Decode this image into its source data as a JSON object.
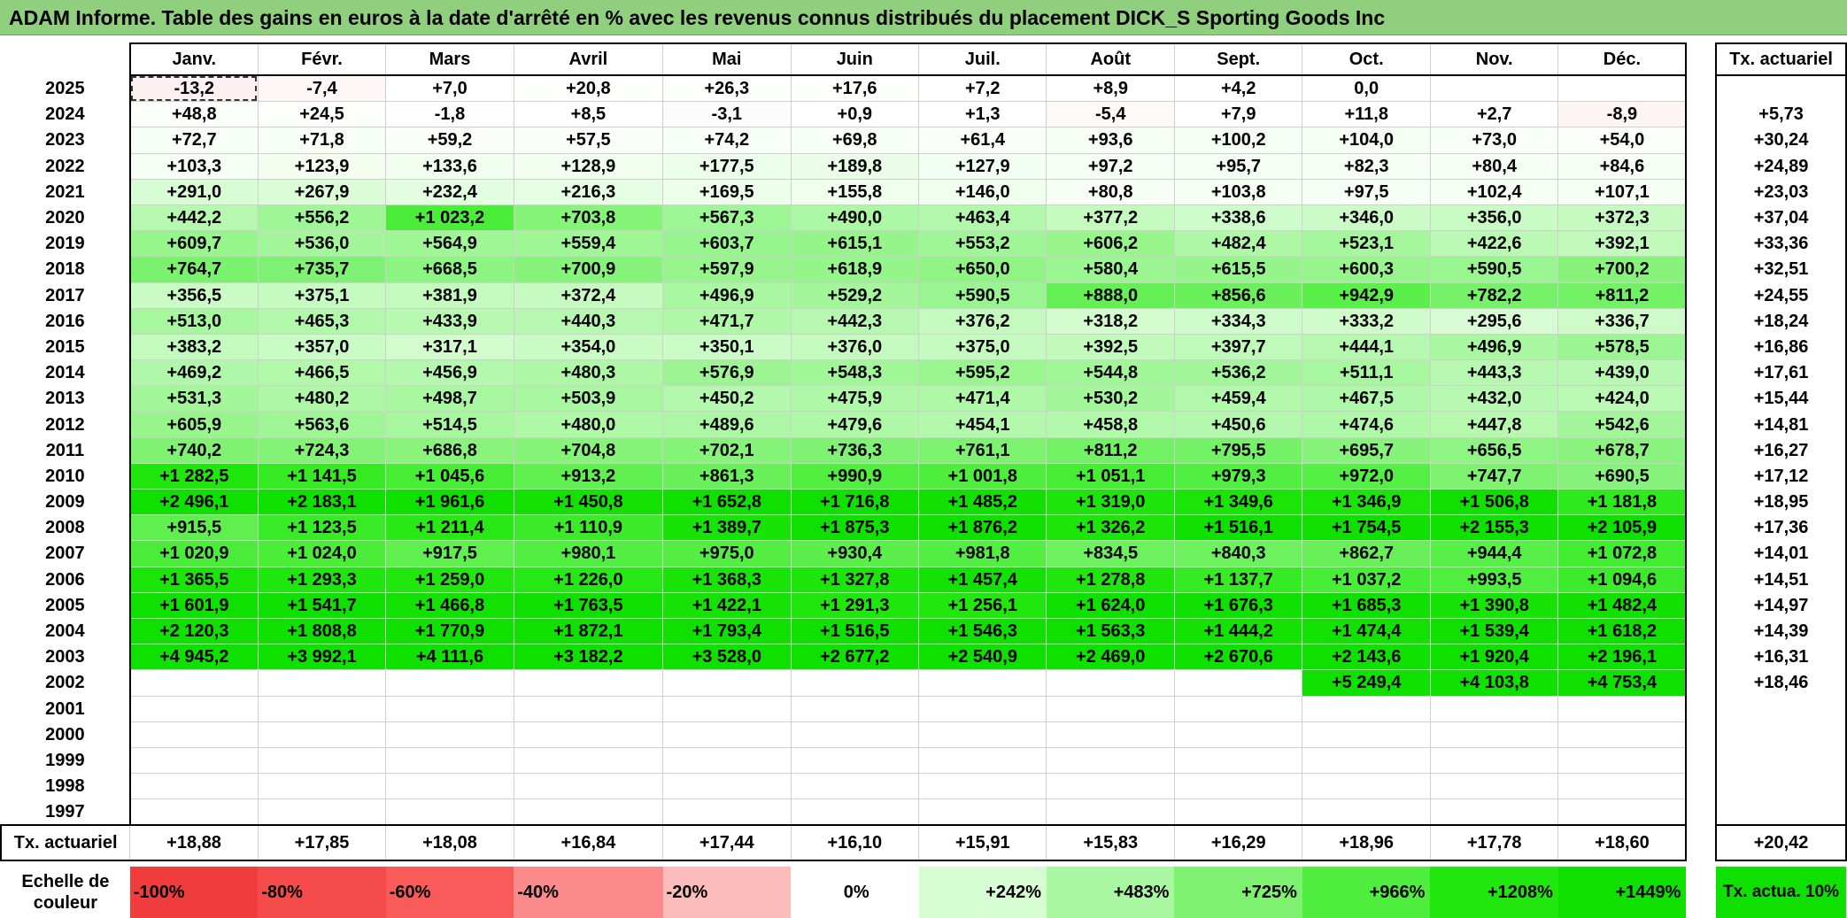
{
  "title": "ADAM Informe. Table des gains en euros à la date d'arrêté en % avec les revenus connus distribués du placement DICK_S Sporting Goods Inc",
  "months": [
    "Janv.",
    "Févr.",
    "Mars",
    "Avril",
    "Mai",
    "Juin",
    "Juil.",
    "Août",
    "Sept.",
    "Oct.",
    "Nov.",
    "Déc."
  ],
  "tax_header": "Tx. actuariel",
  "rows": [
    {
      "year": "2025",
      "values": [
        "-13,2",
        "-7,4",
        "+7,0",
        "+20,8",
        "+26,3",
        "+17,6",
        "+7,2",
        "+8,9",
        "+4,2",
        "0,0",
        "",
        ""
      ],
      "tax": ""
    },
    {
      "year": "2024",
      "values": [
        "+48,8",
        "+24,5",
        "-1,8",
        "+8,5",
        "-3,1",
        "+0,9",
        "+1,3",
        "-5,4",
        "+7,9",
        "+11,8",
        "+2,7",
        "-8,9"
      ],
      "tax": "+5,73"
    },
    {
      "year": "2023",
      "values": [
        "+72,7",
        "+71,8",
        "+59,2",
        "+57,5",
        "+74,2",
        "+69,8",
        "+61,4",
        "+93,6",
        "+100,2",
        "+104,0",
        "+73,0",
        "+54,0"
      ],
      "tax": "+30,24"
    },
    {
      "year": "2022",
      "values": [
        "+103,3",
        "+123,9",
        "+133,6",
        "+128,9",
        "+177,5",
        "+189,8",
        "+127,9",
        "+97,2",
        "+95,7",
        "+82,3",
        "+80,4",
        "+84,6"
      ],
      "tax": "+24,89"
    },
    {
      "year": "2021",
      "values": [
        "+291,0",
        "+267,9",
        "+232,4",
        "+216,3",
        "+169,5",
        "+155,8",
        "+146,0",
        "+80,8",
        "+103,8",
        "+97,5",
        "+102,4",
        "+107,1"
      ],
      "tax": "+23,03"
    },
    {
      "year": "2020",
      "values": [
        "+442,2",
        "+556,2",
        "+1 023,2",
        "+703,8",
        "+567,3",
        "+490,0",
        "+463,4",
        "+377,2",
        "+338,6",
        "+346,0",
        "+356,0",
        "+372,3"
      ],
      "tax": "+37,04"
    },
    {
      "year": "2019",
      "values": [
        "+609,7",
        "+536,0",
        "+564,9",
        "+559,4",
        "+603,7",
        "+615,1",
        "+553,2",
        "+606,2",
        "+482,4",
        "+523,1",
        "+422,6",
        "+392,1"
      ],
      "tax": "+33,36"
    },
    {
      "year": "2018",
      "values": [
        "+764,7",
        "+735,7",
        "+668,5",
        "+700,9",
        "+597,9",
        "+618,9",
        "+650,0",
        "+580,4",
        "+615,5",
        "+600,3",
        "+590,5",
        "+700,2"
      ],
      "tax": "+32,51"
    },
    {
      "year": "2017",
      "values": [
        "+356,5",
        "+375,1",
        "+381,9",
        "+372,4",
        "+496,9",
        "+529,2",
        "+590,5",
        "+888,0",
        "+856,6",
        "+942,9",
        "+782,2",
        "+811,2"
      ],
      "tax": "+24,55"
    },
    {
      "year": "2016",
      "values": [
        "+513,0",
        "+465,3",
        "+433,9",
        "+440,3",
        "+471,7",
        "+442,3",
        "+376,2",
        "+318,2",
        "+334,3",
        "+333,2",
        "+295,6",
        "+336,7"
      ],
      "tax": "+18,24"
    },
    {
      "year": "2015",
      "values": [
        "+383,2",
        "+357,0",
        "+317,1",
        "+354,0",
        "+350,1",
        "+376,0",
        "+375,0",
        "+392,5",
        "+397,7",
        "+444,1",
        "+496,9",
        "+578,5"
      ],
      "tax": "+16,86"
    },
    {
      "year": "2014",
      "values": [
        "+469,2",
        "+466,5",
        "+456,9",
        "+480,3",
        "+576,9",
        "+548,3",
        "+595,2",
        "+544,8",
        "+536,2",
        "+511,1",
        "+443,3",
        "+439,0"
      ],
      "tax": "+17,61"
    },
    {
      "year": "2013",
      "values": [
        "+531,3",
        "+480,2",
        "+498,7",
        "+503,9",
        "+450,2",
        "+475,9",
        "+471,4",
        "+530,2",
        "+459,4",
        "+467,5",
        "+432,0",
        "+424,0"
      ],
      "tax": "+15,44"
    },
    {
      "year": "2012",
      "values": [
        "+605,9",
        "+563,6",
        "+514,5",
        "+480,0",
        "+489,6",
        "+479,6",
        "+454,1",
        "+458,8",
        "+450,6",
        "+474,6",
        "+447,8",
        "+542,6"
      ],
      "tax": "+14,81"
    },
    {
      "year": "2011",
      "values": [
        "+740,2",
        "+724,3",
        "+686,8",
        "+704,8",
        "+702,1",
        "+736,3",
        "+761,1",
        "+811,2",
        "+795,5",
        "+695,7",
        "+656,5",
        "+678,7"
      ],
      "tax": "+16,27"
    },
    {
      "year": "2010",
      "values": [
        "+1 282,5",
        "+1 141,5",
        "+1 045,6",
        "+913,2",
        "+861,3",
        "+990,9",
        "+1 001,8",
        "+1 051,1",
        "+979,3",
        "+972,0",
        "+747,7",
        "+690,5"
      ],
      "tax": "+17,12"
    },
    {
      "year": "2009",
      "values": [
        "+2 496,1",
        "+2 183,1",
        "+1 961,6",
        "+1 450,8",
        "+1 652,8",
        "+1 716,8",
        "+1 485,2",
        "+1 319,0",
        "+1 349,6",
        "+1 346,9",
        "+1 506,8",
        "+1 181,8"
      ],
      "tax": "+18,95"
    },
    {
      "year": "2008",
      "values": [
        "+915,5",
        "+1 123,5",
        "+1 211,4",
        "+1 110,9",
        "+1 389,7",
        "+1 875,3",
        "+1 876,2",
        "+1 326,2",
        "+1 516,1",
        "+1 754,5",
        "+2 155,3",
        "+2 105,9"
      ],
      "tax": "+17,36"
    },
    {
      "year": "2007",
      "values": [
        "+1 020,9",
        "+1 024,0",
        "+917,5",
        "+980,1",
        "+975,0",
        "+930,4",
        "+981,8",
        "+834,5",
        "+840,3",
        "+862,7",
        "+944,4",
        "+1 072,8"
      ],
      "tax": "+14,01"
    },
    {
      "year": "2006",
      "values": [
        "+1 365,5",
        "+1 293,3",
        "+1 259,0",
        "+1 226,0",
        "+1 368,3",
        "+1 327,8",
        "+1 457,4",
        "+1 278,8",
        "+1 137,7",
        "+1 037,2",
        "+993,5",
        "+1 094,6"
      ],
      "tax": "+14,51"
    },
    {
      "year": "2005",
      "values": [
        "+1 601,9",
        "+1 541,7",
        "+1 466,8",
        "+1 763,5",
        "+1 422,1",
        "+1 291,3",
        "+1 256,1",
        "+1 624,0",
        "+1 676,3",
        "+1 685,3",
        "+1 390,8",
        "+1 482,4"
      ],
      "tax": "+14,97"
    },
    {
      "year": "2004",
      "values": [
        "+2 120,3",
        "+1 808,8",
        "+1 770,9",
        "+1 872,1",
        "+1 793,4",
        "+1 516,5",
        "+1 546,3",
        "+1 563,3",
        "+1 444,2",
        "+1 474,4",
        "+1 539,4",
        "+1 618,2"
      ],
      "tax": "+14,39"
    },
    {
      "year": "2003",
      "values": [
        "+4 945,2",
        "+3 992,1",
        "+4 111,6",
        "+3 182,2",
        "+3 528,0",
        "+2 677,2",
        "+2 540,9",
        "+2 469,0",
        "+2 670,6",
        "+2 143,6",
        "+1 920,4",
        "+2 196,1"
      ],
      "tax": "+16,31"
    },
    {
      "year": "2002",
      "values": [
        "",
        "",
        "",
        "",
        "",
        "",
        "",
        "",
        "",
        "+5 249,4",
        "+4 103,8",
        "+4 753,4"
      ],
      "tax": "+18,46"
    },
    {
      "year": "2001",
      "values": [
        "",
        "",
        "",
        "",
        "",
        "",
        "",
        "",
        "",
        "",
        "",
        ""
      ],
      "tax": ""
    },
    {
      "year": "2000",
      "values": [
        "",
        "",
        "",
        "",
        "",
        "",
        "",
        "",
        "",
        "",
        "",
        ""
      ],
      "tax": ""
    },
    {
      "year": "1999",
      "values": [
        "",
        "",
        "",
        "",
        "",
        "",
        "",
        "",
        "",
        "",
        "",
        ""
      ],
      "tax": ""
    },
    {
      "year": "1998",
      "values": [
        "",
        "",
        "",
        "",
        "",
        "",
        "",
        "",
        "",
        "",
        "",
        ""
      ],
      "tax": ""
    },
    {
      "year": "1997",
      "values": [
        "",
        "",
        "",
        "",
        "",
        "",
        "",
        "",
        "",
        "",
        "",
        ""
      ],
      "tax": ""
    }
  ],
  "footer": {
    "label": "Tx. actuariel",
    "values": [
      "+18,88",
      "+17,85",
      "+18,08",
      "+16,84",
      "+17,44",
      "+16,10",
      "+15,91",
      "+15,83",
      "+16,29",
      "+18,96",
      "+17,78",
      "+18,60"
    ],
    "total": "+20,42"
  },
  "scale": {
    "label": "Echelle de couleur",
    "steps": [
      {
        "text": "-100%",
        "color": "#f03c3c"
      },
      {
        "text": "-80%",
        "color": "#f54b4b"
      },
      {
        "text": "-60%",
        "color": "#f95a5a"
      },
      {
        "text": "-40%",
        "color": "#fb8a8a"
      },
      {
        "text": "-20%",
        "color": "#fdbcbc"
      },
      {
        "text": "0%",
        "color": "#ffffff"
      },
      {
        "text": "+242%",
        "color": "#d6fcd2"
      },
      {
        "text": "+483%",
        "color": "#a9f7a1"
      },
      {
        "text": "+725%",
        "color": "#7ef270"
      },
      {
        "text": "+966%",
        "color": "#4fee3e"
      },
      {
        "text": "+1208%",
        "color": "#22e70f"
      },
      {
        "text": "+1449%",
        "color": "#10e000"
      }
    ],
    "tax_label": "Tx. actua. 10%",
    "tax_color": "#10e000"
  }
}
